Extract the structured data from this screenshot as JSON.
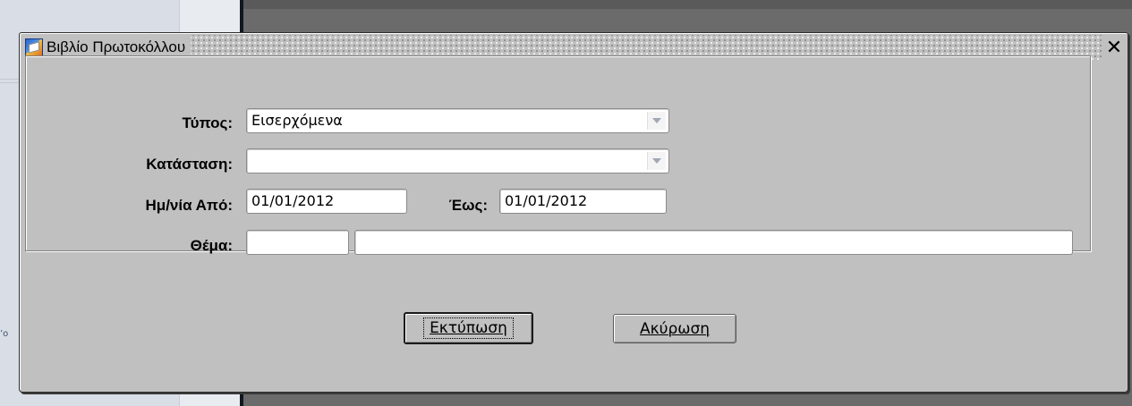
{
  "background": {
    "edge_glyph": "’o"
  },
  "dialog": {
    "title": "Βιβλίο Πρωτοκόλλου",
    "close_symbol": "✕"
  },
  "form": {
    "type": {
      "label": "Τύπος:",
      "value": "Εισερχόμενα"
    },
    "status": {
      "label": "Κατάσταση:",
      "value": ""
    },
    "date_from": {
      "label": "Ημ/νία Από:",
      "value": "01/01/2012"
    },
    "date_to": {
      "label": "Έως:",
      "value": "01/01/2012"
    },
    "subject": {
      "label": "Θέμα:",
      "code_value": "",
      "text_value": ""
    }
  },
  "buttons": {
    "print_label": "Εκτύπωση",
    "cancel_label": "Ακύρωση"
  },
  "colors": {
    "dialog_bg": "#c0c0c0",
    "field_bg": "#ffffff",
    "backdrop": "#6b6b6b"
  },
  "icons": {
    "app": "oracle-forms-app-icon",
    "close": "close-icon",
    "dropdown": "chevron-down-icon"
  }
}
